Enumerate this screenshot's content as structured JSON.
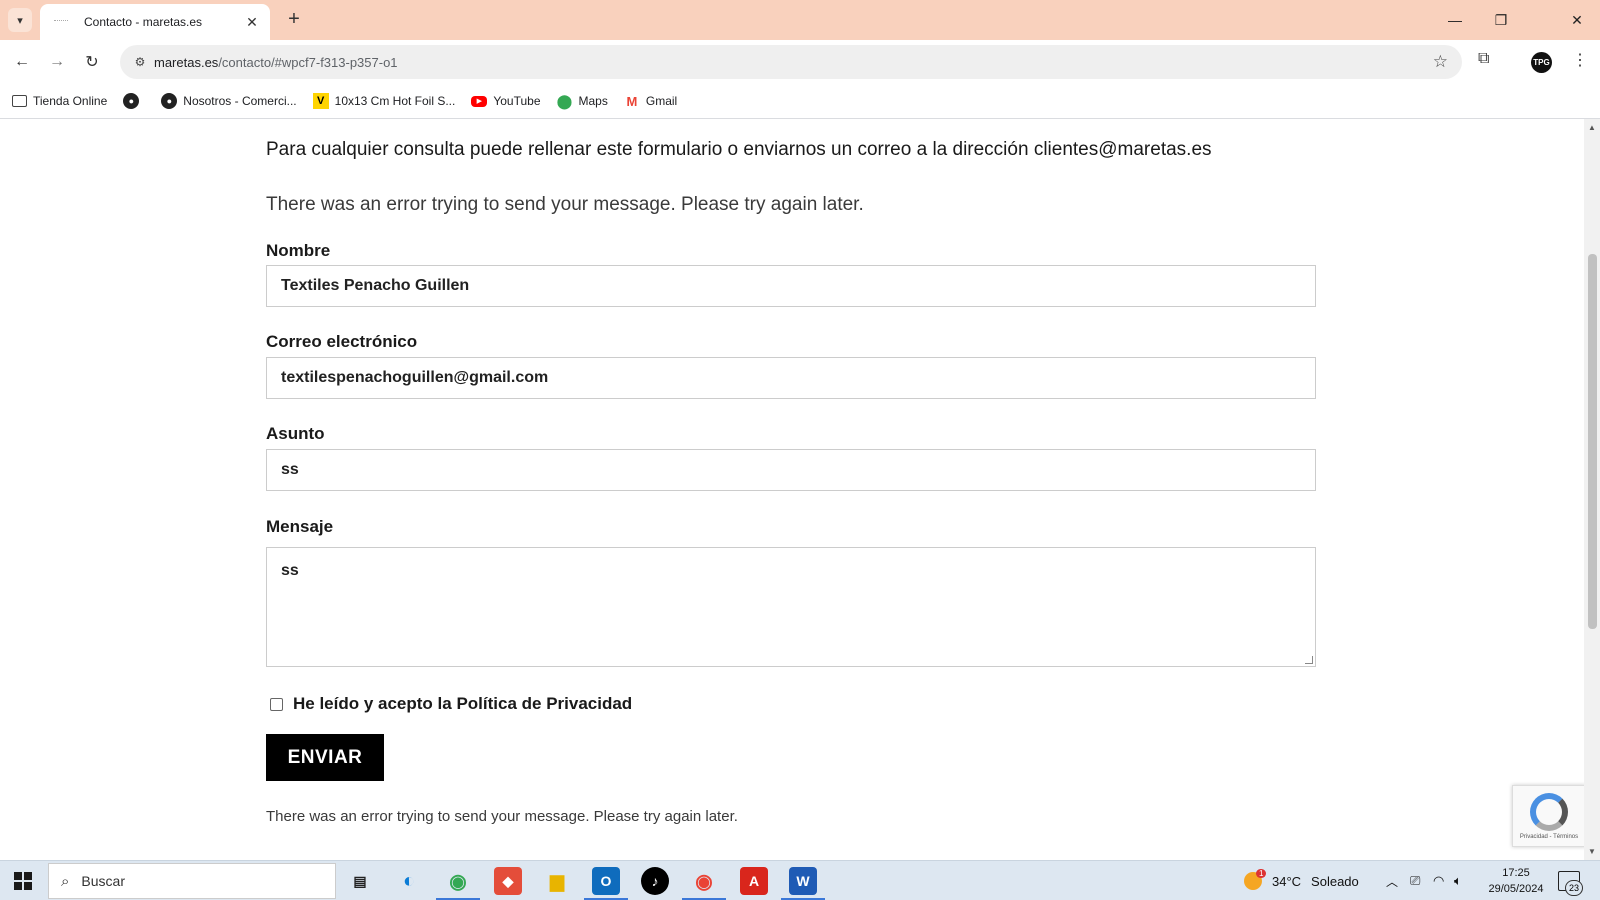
{
  "browser": {
    "tab_title": "Contacto - maretas.es",
    "tab_close": "✕",
    "new_tab": "+",
    "url_domain": "maretas.es",
    "url_path": "/contacto/#wpcf7-f313-p357-o1",
    "profile_initials": "TPG",
    "window_controls": {
      "minimize": "—",
      "restore": "❐",
      "close": "✕"
    }
  },
  "bookmarks": [
    {
      "label": "Tienda Online",
      "icon": "folder-icon"
    },
    {
      "label": "",
      "icon": "globe-icon"
    },
    {
      "label": "Nosotros - Comerci...",
      "icon": "globe-icon"
    },
    {
      "label": "10x13 Cm Hot Foil S...",
      "icon": "v-logo-icon"
    },
    {
      "label": "YouTube",
      "icon": "youtube-icon"
    },
    {
      "label": "Maps",
      "icon": "maps-icon"
    },
    {
      "label": "Gmail",
      "icon": "gmail-icon"
    }
  ],
  "page": {
    "intro": "Para cualquier consulta puede rellenar este formulario o enviarnos un correo a la dirección clientes@maretas.es",
    "error_top": "There was an error trying to send your message. Please try again later.",
    "form": {
      "name_label": "Nombre",
      "name_value": "Textiles Penacho Guillen",
      "email_label": "Correo electrónico",
      "email_value": "textilespenachoguillen@gmail.com",
      "subject_label": "Asunto",
      "subject_value": "ss",
      "message_label": "Mensaje",
      "message_value": "ss",
      "privacy_prefix": "He leído y acepto la ",
      "privacy_link": "Política de Privacidad",
      "submit_label": "ENVIAR"
    },
    "error_bottom": "There was an error trying to send your message. Please try again later.",
    "recaptcha_terms": "Privacidad - Términos"
  },
  "taskbar": {
    "search_placeholder": "Buscar",
    "weather_temp": "34°C",
    "weather_desc": "Soleado",
    "weather_badge": "1",
    "time": "17:25",
    "date": "29/05/2024",
    "notifications_count": "23"
  }
}
